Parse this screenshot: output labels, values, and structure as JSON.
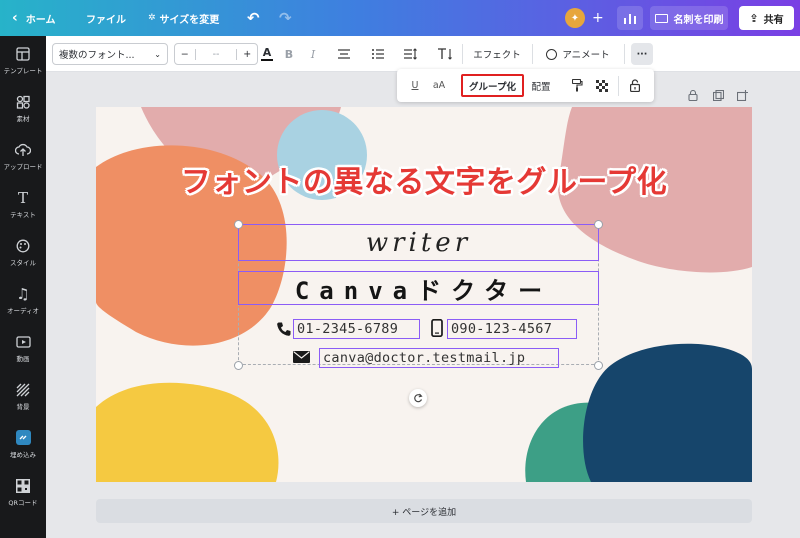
{
  "topbar": {
    "home": "ホーム",
    "file": "ファイル",
    "resize": "サイズを変更",
    "print_cards": "名刺を印刷",
    "share": "共有"
  },
  "sidebar": {
    "items": [
      {
        "label": "テンプレート",
        "icon": "template-icon"
      },
      {
        "label": "素材",
        "icon": "elements-icon"
      },
      {
        "label": "アップロード",
        "icon": "upload-icon"
      },
      {
        "label": "テキスト",
        "icon": "text-icon"
      },
      {
        "label": "スタイル",
        "icon": "palette-icon"
      },
      {
        "label": "オーディオ",
        "icon": "music-icon"
      },
      {
        "label": "動画",
        "icon": "video-icon"
      },
      {
        "label": "背景",
        "icon": "background-icon"
      },
      {
        "label": "埋め込み",
        "icon": "embed-icon"
      },
      {
        "label": "QRコード",
        "icon": "qrcode-icon"
      }
    ]
  },
  "toolbar": {
    "font_select": "複数のフォント...",
    "font_size_value": "-- ",
    "minus": "−",
    "plus": "+",
    "effects": "エフェクト",
    "animate": "アニメート",
    "more": "···"
  },
  "floatbar": {
    "underline": "U",
    "case": "aA",
    "group": "グループ化",
    "arrange": "配置"
  },
  "canvas": {
    "annotation": "フォントの異なる文字をグループ化",
    "writer": "writer",
    "doctor": "Canvaドクター",
    "phone1": "01-2345-6789",
    "phone2": "090-123-4567",
    "email": "canva@doctor.testmail.jp",
    "add_page": "+ ページを追加"
  },
  "colors": {
    "accent_purple": "#8b5cf6",
    "highlight_red": "#e02020",
    "annotation_red": "#e53935"
  }
}
